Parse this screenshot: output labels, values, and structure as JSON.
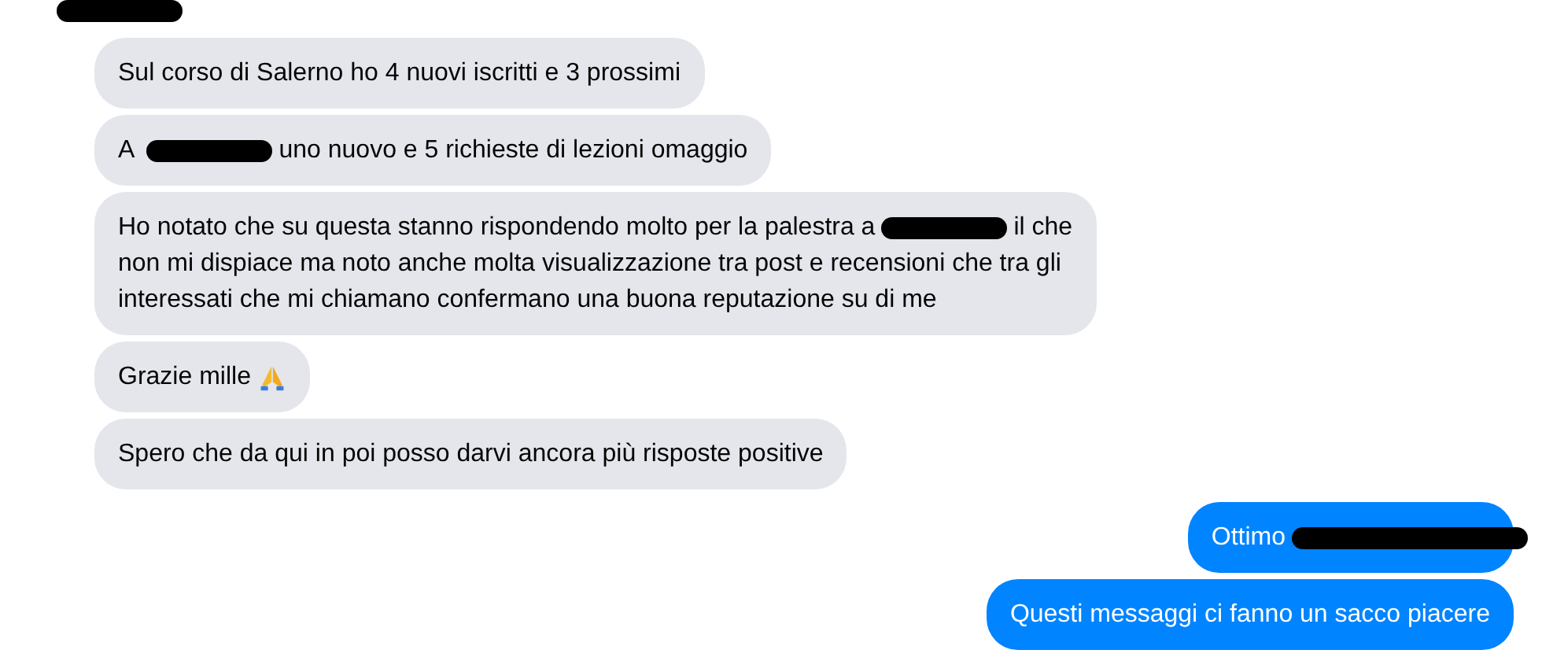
{
  "top_mark": {
    "kind": "redaction"
  },
  "messages": [
    {
      "sent": false,
      "lines": [
        [
          {
            "kind": "text",
            "text": "Sul corso di Salerno ho 4 nuovi iscritti e 3 prossimi"
          }
        ]
      ]
    },
    {
      "sent": false,
      "lines": [
        [
          {
            "kind": "text",
            "text": "A "
          },
          {
            "kind": "redaction"
          },
          {
            "kind": "text",
            "text": "uno nuovo e 5 richieste di lezioni omaggio"
          }
        ]
      ]
    },
    {
      "sent": false,
      "lines": [
        [
          {
            "kind": "text",
            "text": "Ho notato che su questa stanno rispondendo molto per la palestra a"
          },
          {
            "kind": "redaction"
          },
          {
            "kind": "text",
            "text": "il che"
          }
        ],
        [
          {
            "kind": "text",
            "text": "non mi dispiace ma noto anche molta visualizzazione tra post e recensioni che tra gli"
          }
        ],
        [
          {
            "kind": "text",
            "text": "interessati che mi chiamano confermano una buona reputazione su di me"
          }
        ]
      ]
    },
    {
      "sent": false,
      "lines": [
        [
          {
            "kind": "text",
            "text": "Grazie mille"
          },
          {
            "kind": "icon"
          }
        ]
      ]
    },
    {
      "sent": false,
      "lines": [
        [
          {
            "kind": "text",
            "text": "Spero che da qui in poi posso darvi ancora più risposte positive"
          }
        ]
      ]
    },
    {
      "sent": true,
      "lines": [
        [
          {
            "kind": "text",
            "text": "Ottimo"
          },
          {
            "kind": "redaction"
          }
        ]
      ]
    },
    {
      "sent": true,
      "lines": [
        [
          {
            "kind": "text",
            "text": "Questi messaggi ci fanno un sacco piacere"
          }
        ]
      ]
    }
  ]
}
